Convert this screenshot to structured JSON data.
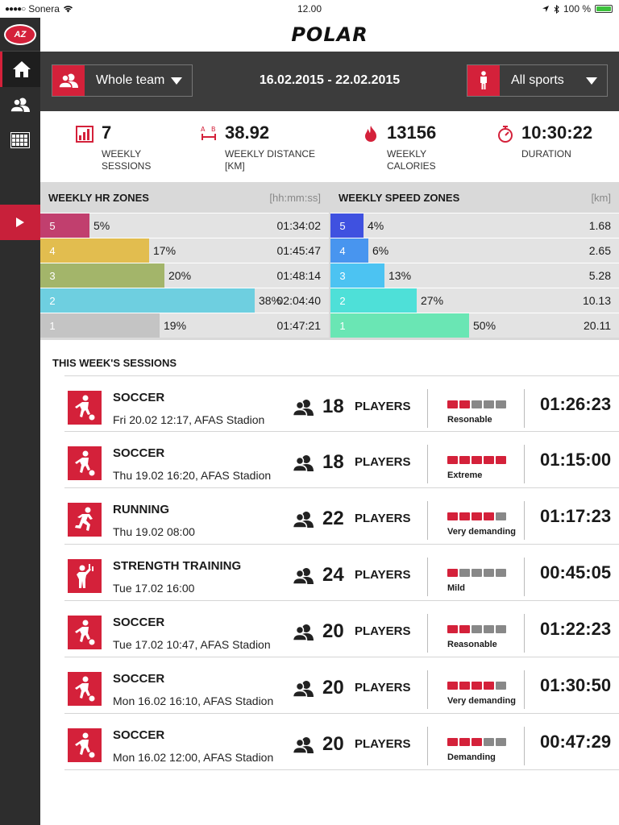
{
  "statusbar": {
    "carrier": "Sonera",
    "time": "12.00",
    "battery": "100 %"
  },
  "brand": {
    "app_logo": "POLAR",
    "club_logo": "AZ",
    "accent": "#d4213a"
  },
  "filters": {
    "team": "Whole team",
    "date_range": "16.02.2015 - 22.02.2015",
    "sport": "All sports"
  },
  "summary": {
    "sessions": {
      "value": "7",
      "label1": "WEEKLY",
      "label2": "SESSIONS"
    },
    "distance": {
      "value": "38.92",
      "label1": "WEEKLY DISTANCE",
      "label2": "[KM]"
    },
    "calories": {
      "value": "13156",
      "label1": "WEEKLY",
      "label2": "CALORIES"
    },
    "duration": {
      "value": "10:30:22",
      "label1": "DURATION",
      "label2": ""
    }
  },
  "hr_zones": {
    "title": "WEEKLY HR ZONES",
    "unit": "[hh:mm:ss]",
    "rows": [
      {
        "zone": "5",
        "pct_label": "5%",
        "pct": 5,
        "value": "01:34:02",
        "color": "#c13f6e"
      },
      {
        "zone": "4",
        "pct_label": "17%",
        "pct": 17,
        "value": "01:45:47",
        "color": "#e2bd4f"
      },
      {
        "zone": "3",
        "pct_label": "20%",
        "pct": 20,
        "value": "01:48:14",
        "color": "#a3b56a"
      },
      {
        "zone": "2",
        "pct_label": "38%",
        "pct": 38,
        "value": "02:04:40",
        "color": "#6ecfe0"
      },
      {
        "zone": "1",
        "pct_label": "19%",
        "pct": 19,
        "value": "01:47:21",
        "color": "#c4c4c4"
      }
    ]
  },
  "speed_zones": {
    "title": "WEEKLY SPEED ZONES",
    "unit": "[km]",
    "rows": [
      {
        "zone": "5",
        "pct_label": "4%",
        "pct": 4,
        "value": "1.68",
        "color": "#3f51e0"
      },
      {
        "zone": "4",
        "pct_label": "6%",
        "pct": 6,
        "value": "2.65",
        "color": "#4895ef"
      },
      {
        "zone": "3",
        "pct_label": "13%",
        "pct": 13,
        "value": "5.28",
        "color": "#4cc3f2"
      },
      {
        "zone": "2",
        "pct_label": "27%",
        "pct": 27,
        "value": "10.13",
        "color": "#4ee0d8"
      },
      {
        "zone": "1",
        "pct_label": "50%",
        "pct": 50,
        "value": "20.11",
        "color": "#6ae6b4"
      }
    ]
  },
  "sessions": {
    "title": "THIS WEEK'S SESSIONS",
    "players_label": "PLAYERS",
    "list": [
      {
        "sport": "SOCCER",
        "icon": "soccer-icon",
        "date": "Fri 20.02 12:17, AFAS Stadion",
        "players": "18",
        "load": 2,
        "load_label": "Resonable",
        "duration": "01:26:23"
      },
      {
        "sport": "SOCCER",
        "icon": "soccer-icon",
        "date": "Thu 19.02 16:20, AFAS Stadion",
        "players": "18",
        "load": 5,
        "load_label": "Extreme",
        "duration": "01:15:00"
      },
      {
        "sport": "RUNNING",
        "icon": "running-icon",
        "date": "Thu 19.02 08:00",
        "players": "22",
        "load": 4,
        "load_label": "Very demanding",
        "duration": "01:17:23"
      },
      {
        "sport": "STRENGTH TRAINING",
        "icon": "strength-icon",
        "date": "Tue 17.02 16:00",
        "players": "24",
        "load": 1,
        "load_label": "Mild",
        "duration": "00:45:05"
      },
      {
        "sport": "SOCCER",
        "icon": "soccer-icon",
        "date": "Tue 17.02 10:47, AFAS Stadion",
        "players": "20",
        "load": 2,
        "load_label": "Reasonable",
        "duration": "01:22:23"
      },
      {
        "sport": "SOCCER",
        "icon": "soccer-icon",
        "date": "Mon 16.02 16:10, AFAS Stadion",
        "players": "20",
        "load": 4,
        "load_label": "Very demanding",
        "duration": "01:30:50"
      },
      {
        "sport": "SOCCER",
        "icon": "soccer-icon",
        "date": "Mon 16.02 12:00, AFAS Stadion",
        "players": "20",
        "load": 3,
        "load_label": "Demanding",
        "duration": "00:47:29"
      }
    ]
  }
}
